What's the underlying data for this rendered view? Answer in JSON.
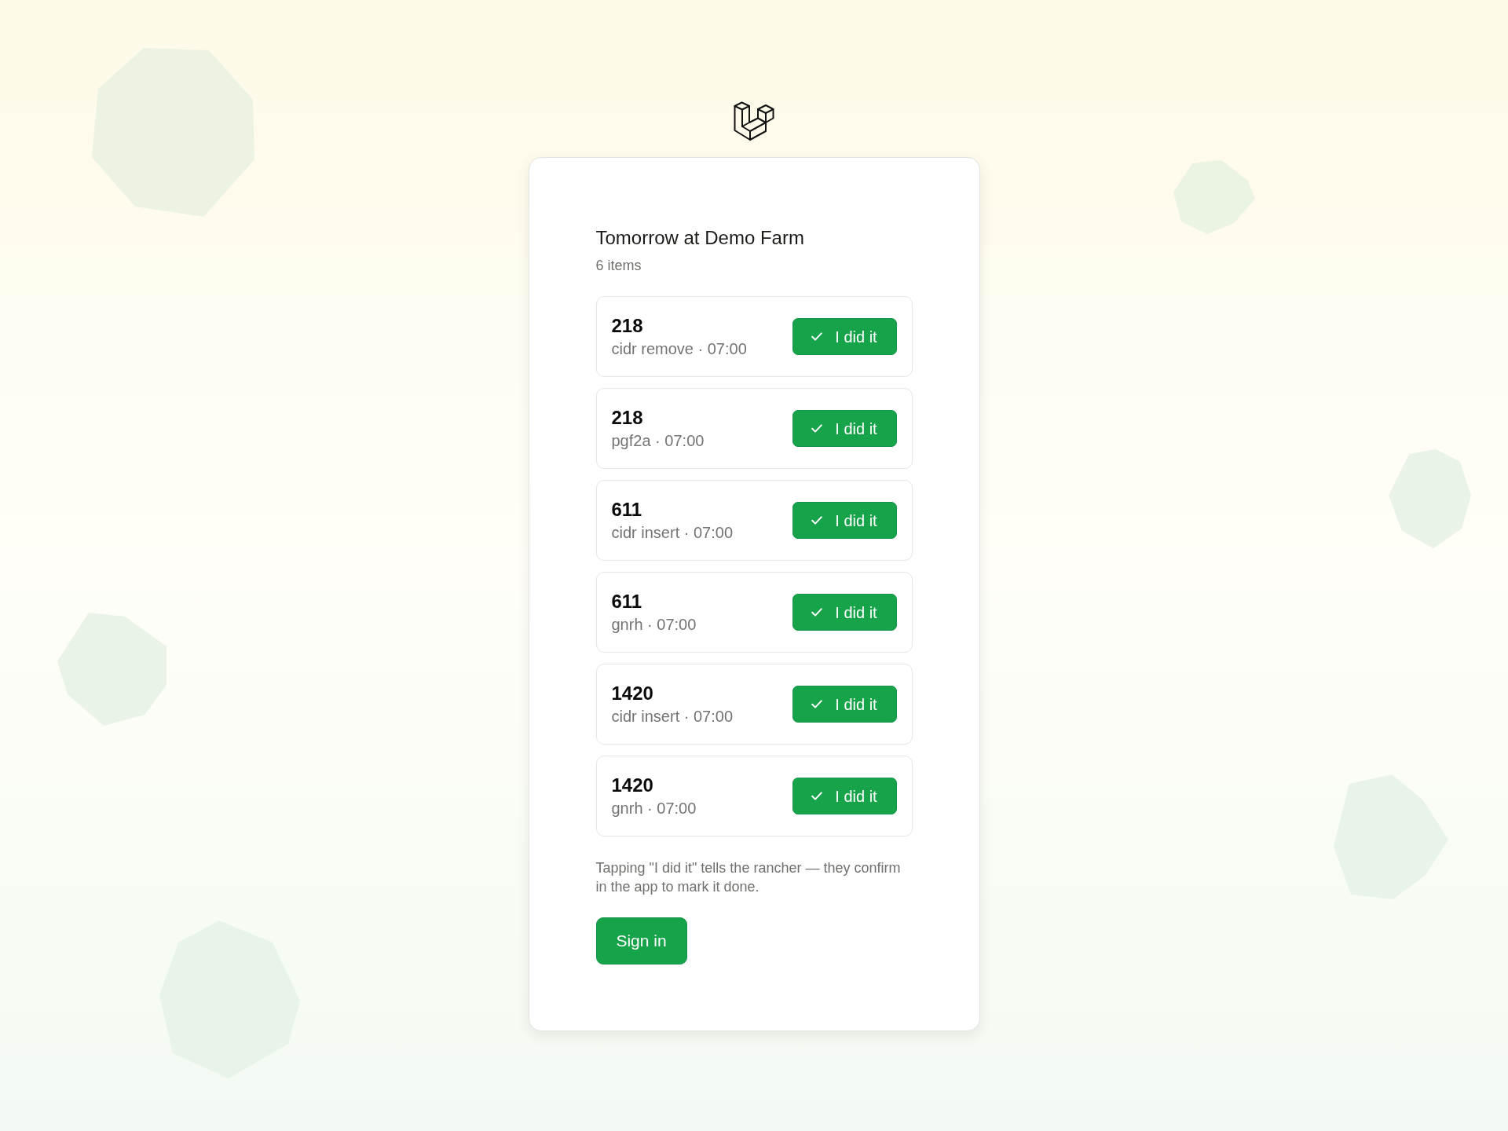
{
  "card": {
    "title": "Tomorrow at Demo Farm",
    "count": "6 items",
    "tasks": [
      {
        "number": "218",
        "detail": "cidr remove · 07:00",
        "button": "I did it"
      },
      {
        "number": "218",
        "detail": "pgf2a · 07:00",
        "button": "I did it"
      },
      {
        "number": "611",
        "detail": "cidr insert · 07:00",
        "button": "I did it"
      },
      {
        "number": "611",
        "detail": "gnrh · 07:00",
        "button": "I did it"
      },
      {
        "number": "1420",
        "detail": "cidr insert · 07:00",
        "button": "I did it"
      },
      {
        "number": "1420",
        "detail": "gnrh · 07:00",
        "button": "I did it"
      }
    ],
    "note": "Tapping \"I did it\" tells the rancher — they confirm in the app to mark it done.",
    "sign_in": "Sign in"
  }
}
